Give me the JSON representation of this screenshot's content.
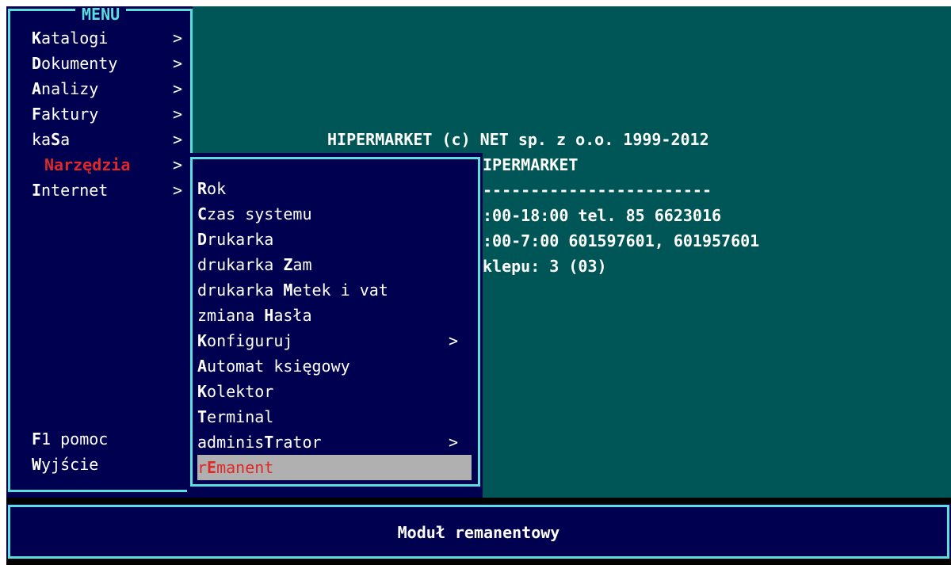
{
  "app": {
    "copyright_line": "HIPERMARKET (c) NET sp. z o.o. 1999-2012",
    "info_lines": [
      "IPERMARKET",
      "------------------------",
      ":00-18:00 tel. 85 6623016",
      ":00-7:00 601597601, 601957601",
      "klepu: 3 (03)"
    ]
  },
  "main_menu": {
    "title": "MENU",
    "items": [
      {
        "hotkey": "K",
        "rest": "atalogi",
        "arrow": ">"
      },
      {
        "hotkey": "D",
        "rest": "okumenty",
        "arrow": ">"
      },
      {
        "hotkey": "A",
        "rest": "nalizy",
        "arrow": ">"
      },
      {
        "hotkey": "F",
        "rest": "aktury",
        "arrow": ">"
      },
      {
        "pre": "ka",
        "hotkey": "S",
        "rest": "a",
        "arrow": ">"
      },
      {
        "label": "Narzędzia",
        "arrow": ">",
        "active": true
      },
      {
        "hotkey": "I",
        "rest": "nternet",
        "arrow": ">"
      }
    ],
    "bottom_items": [
      {
        "hotkey": "F",
        "rest": "1 pomoc"
      },
      {
        "hotkey": "W",
        "rest": "yjście"
      }
    ]
  },
  "submenu": {
    "items": [
      {
        "pre": "",
        "hotkey": "R",
        "rest": "ok",
        "arrow": ""
      },
      {
        "pre": "",
        "hotkey": "C",
        "rest": "zas systemu",
        "arrow": ""
      },
      {
        "pre": "",
        "hotkey": "D",
        "rest": "rukarka",
        "arrow": ""
      },
      {
        "pre": "drukarka ",
        "hotkey": "Z",
        "rest": "am",
        "arrow": ""
      },
      {
        "pre": "drukarka ",
        "hotkey": "M",
        "rest": "etek i vat",
        "arrow": ""
      },
      {
        "pre": "zmiana ",
        "hotkey": "H",
        "rest": "asła",
        "arrow": ""
      },
      {
        "pre": "",
        "hotkey": "K",
        "rest": "onfiguruj",
        "arrow": ">"
      },
      {
        "pre": "",
        "hotkey": "A",
        "rest": "utomat księgowy",
        "arrow": ""
      },
      {
        "pre": "",
        "hotkey": "K",
        "rest": "olektor",
        "arrow": ""
      },
      {
        "pre": "",
        "hotkey": "T",
        "rest": "erminal",
        "arrow": ""
      },
      {
        "pre": "adminis",
        "hotkey": "T",
        "rest": "rator",
        "arrow": ">"
      },
      {
        "pre": "r",
        "hotkey": "E",
        "rest": "manent",
        "arrow": "",
        "selected": true
      }
    ]
  },
  "status_bar": {
    "text": "Moduł remanentowy"
  },
  "colors": {
    "menu_bg": "#000050",
    "border": "#5cdede",
    "desktop": "#005656",
    "highlight_text": "#e02828",
    "selection_bg": "#b0b0b0"
  }
}
